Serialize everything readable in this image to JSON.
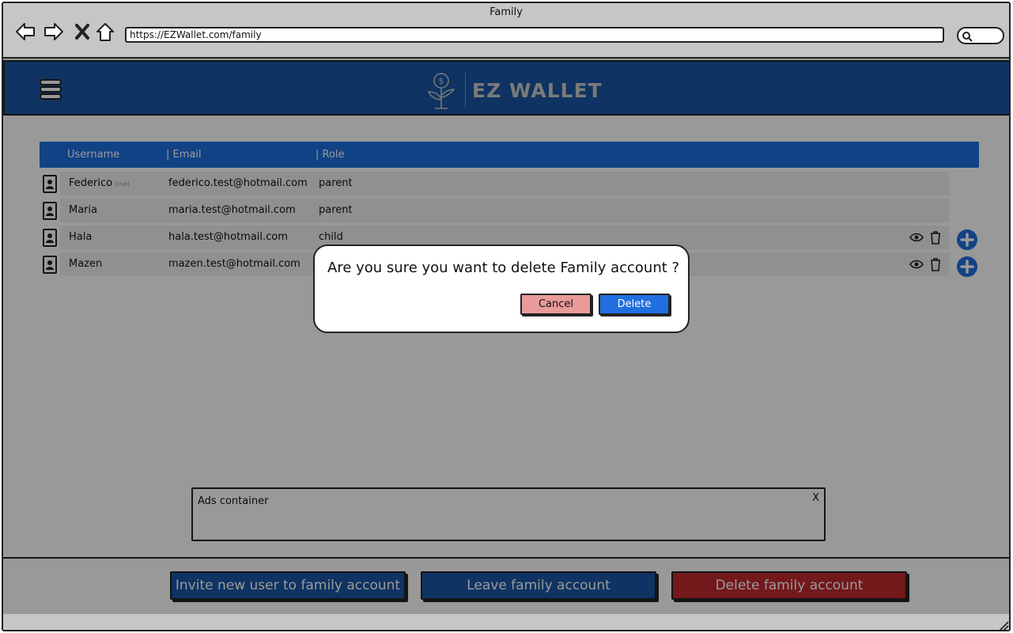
{
  "browser": {
    "window_title": "Family",
    "url": "https://EZWallet.com/family"
  },
  "header": {
    "brand": "EZ WALLET",
    "accent": "#1f6fe0"
  },
  "table": {
    "columns": [
      "Username",
      "| Email",
      "| Role"
    ],
    "rows": [
      {
        "username": "Federico",
        "tag": "(me)",
        "email": "federico.test@hotmail.com",
        "role": "parent",
        "actions": false
      },
      {
        "username": "Maria",
        "tag": "",
        "email": "maria.test@hotmail.com",
        "role": "parent",
        "actions": false
      },
      {
        "username": "Hala",
        "tag": "",
        "email": "hala.test@hotmail.com",
        "role": "child",
        "actions": true
      },
      {
        "username": "Mazen",
        "tag": "",
        "email": "mazen.test@hotmail.com",
        "role": "",
        "actions": true
      }
    ]
  },
  "ads": {
    "label": "Ads container",
    "close": "X"
  },
  "footer": {
    "invite_label": "Invite new user to family account",
    "leave_label": "Leave family account",
    "delete_label": "Delete family account",
    "invite_color": "#1a55a3",
    "leave_color": "#1a55a3",
    "delete_color": "#c0282d"
  },
  "dialog": {
    "message": "Are you sure you want to delete Family account ?",
    "cancel_label": "Cancel",
    "delete_label": "Delete",
    "cancel_color": "#e89b98",
    "delete_color": "#1f6fe0"
  },
  "icons": {
    "back": "back-arrow-icon",
    "forward": "forward-arrow-icon",
    "stop": "close-icon",
    "home": "home-icon",
    "search": "search-icon",
    "menu": "hamburger-menu-icon",
    "logo": "money-plant-icon",
    "user": "user-icon",
    "view": "eye-icon",
    "delete": "trash-icon",
    "add": "plus-circle-icon"
  }
}
